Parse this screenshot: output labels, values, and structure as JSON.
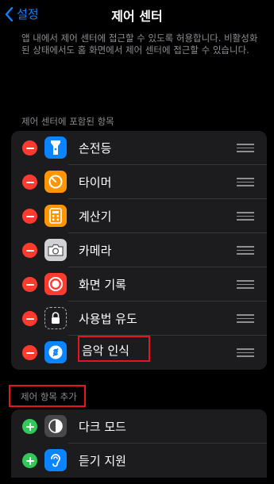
{
  "nav": {
    "back_label": "설정",
    "title": "제어 센터"
  },
  "description": "앱 내에서 제어 센터에 접근할 수 있도록 허용합니다. 비활성화된 상태에서도 홈 화면에서 제어 센터에 접근할 수 있습니다.",
  "included": {
    "header": "제어 센터에 포함된 항목",
    "items": [
      {
        "label": "손전등",
        "icon": "flashlight-icon",
        "color": "#0a84ff"
      },
      {
        "label": "타이머",
        "icon": "timer-icon",
        "color": "#ff9500"
      },
      {
        "label": "계산기",
        "icon": "calculator-icon",
        "color": "#ff9500"
      },
      {
        "label": "카메라",
        "icon": "camera-icon",
        "color": "#8e8e93"
      },
      {
        "label": "화면 기록",
        "icon": "screen-record-icon",
        "color": "#ff3b30"
      },
      {
        "label": "사용법 유도",
        "icon": "guided-access-icon",
        "color": "#1c1c1e"
      },
      {
        "label": "음악 인식",
        "icon": "shazam-icon",
        "color": "#0a84ff"
      }
    ]
  },
  "more": {
    "header": "제어 항목 추가",
    "items": [
      {
        "label": "다크 모드",
        "icon": "dark-mode-icon",
        "color": "#48484a"
      },
      {
        "label": "듣기 지원",
        "icon": "hearing-icon",
        "color": "#0a84ff"
      }
    ]
  },
  "annotation_color": "#e8141e"
}
